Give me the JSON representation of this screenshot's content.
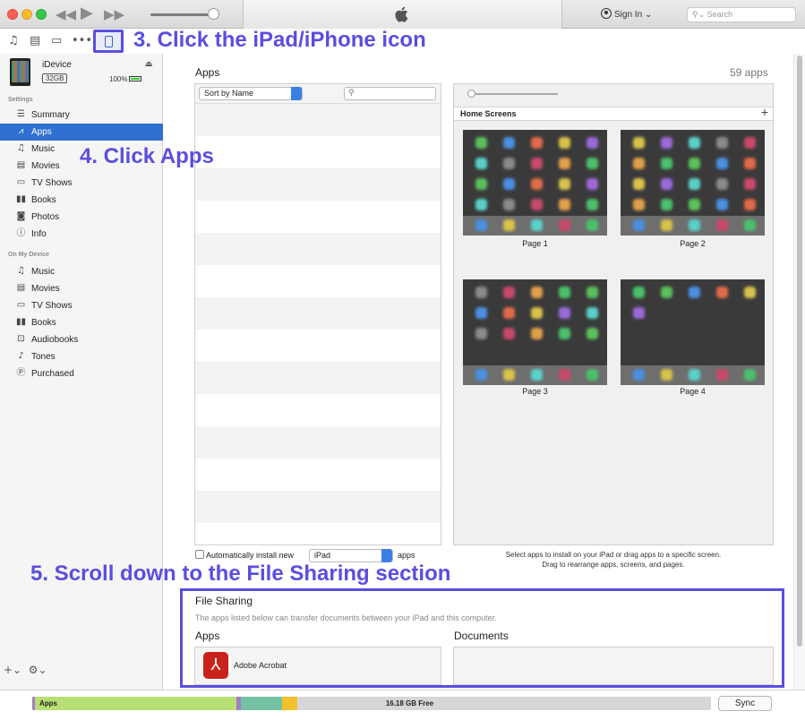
{
  "toolbar": {
    "sign_in": "Sign In",
    "search_placeholder": "Search",
    "colors": {
      "annotation": "#5a4ee0",
      "selection": "#2f6fcf"
    }
  },
  "device": {
    "name": "iDevice",
    "capacity": "32GB",
    "battery": "100%"
  },
  "sidebar": {
    "settings_header": "Settings",
    "settings_items": [
      {
        "label": "Summary",
        "icon": "summary-icon",
        "active": false
      },
      {
        "label": "Apps",
        "icon": "apps-icon",
        "active": true
      },
      {
        "label": "Music",
        "icon": "music-icon",
        "active": false
      },
      {
        "label": "Movies",
        "icon": "movies-icon",
        "active": false
      },
      {
        "label": "TV Shows",
        "icon": "tv-icon",
        "active": false
      },
      {
        "label": "Books",
        "icon": "books-icon",
        "active": false
      },
      {
        "label": "Photos",
        "icon": "camera-icon",
        "active": false
      },
      {
        "label": "Info",
        "icon": "info-icon",
        "active": false
      }
    ],
    "device_header": "On My Device",
    "device_items": [
      {
        "label": "Music",
        "icon": "music-icon"
      },
      {
        "label": "Movies",
        "icon": "movies-icon"
      },
      {
        "label": "TV Shows",
        "icon": "tv-icon"
      },
      {
        "label": "Books",
        "icon": "books-icon"
      },
      {
        "label": "Audiobooks",
        "icon": "audiobooks-icon"
      },
      {
        "label": "Tones",
        "icon": "bell-icon"
      },
      {
        "label": "Purchased",
        "icon": "purchased-icon"
      }
    ]
  },
  "apps_panel": {
    "title": "Apps",
    "count": "59 apps",
    "sort_label": "Sort by Name",
    "home_screens_label": "Home Screens",
    "pages": [
      "Page 1",
      "Page 2",
      "Page 3",
      "Page 4"
    ],
    "auto_install_label": "Automatically install new",
    "auto_install_device": "iPad",
    "auto_install_suffix": "apps",
    "hint_line1": "Select apps to install on your iPad or drag apps to a specific screen.",
    "hint_line2": "Drag to rearrange apps, screens, and pages."
  },
  "file_sharing": {
    "title": "File Sharing",
    "description": "The apps listed below can transfer documents between your iPad and this computer.",
    "apps_header": "Apps",
    "documents_header": "Documents",
    "apps": [
      {
        "name": "Adobe Acrobat",
        "icon": "acrobat-icon"
      }
    ]
  },
  "storage": {
    "apps_label": "Apps",
    "free_label": "16.18 GB Free",
    "sync_label": "Sync",
    "colors": {
      "apps": "#b7df74",
      "purple": "#a57cc8",
      "other": "#74c2a3",
      "yellow": "#f2c12e"
    }
  },
  "annotations": {
    "step3": "3. Click the iPad/iPhone icon",
    "step4": "4. Click Apps",
    "step5": "5. Scroll down to the File Sharing section"
  }
}
